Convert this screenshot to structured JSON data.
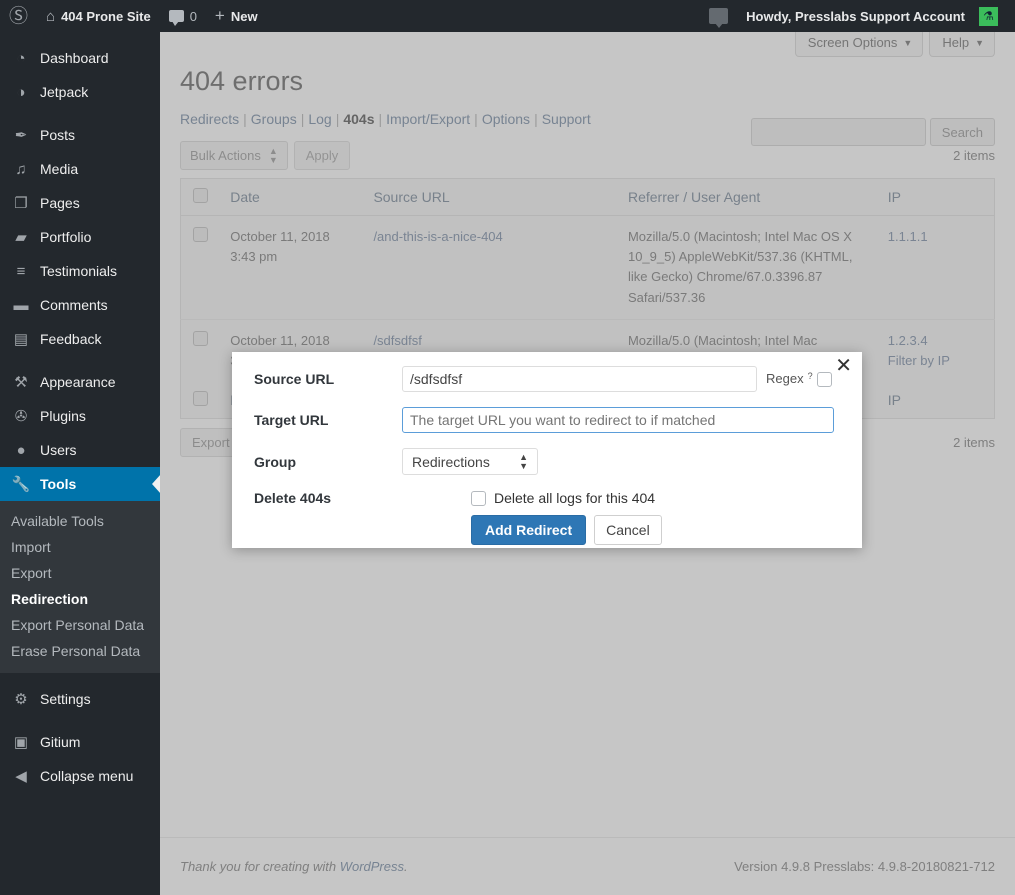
{
  "adminbar": {
    "logo_icon": "wordpress-logo-icon",
    "site_name": "404 Prone Site",
    "comments_count": "0",
    "new_label": "New",
    "greeting": "Howdy, Presslabs Support Account",
    "avatar_glyph": "⚗"
  },
  "sidebar": {
    "items": [
      {
        "label": "Dashboard",
        "icon": "dashboard-icon",
        "glyph": "◔"
      },
      {
        "label": "Jetpack",
        "icon": "jetpack-icon",
        "glyph": "◑"
      },
      {
        "label": "Posts",
        "icon": "pin-icon",
        "glyph": "✒"
      },
      {
        "label": "Media",
        "icon": "media-icon",
        "glyph": "♫"
      },
      {
        "label": "Pages",
        "icon": "pages-icon",
        "glyph": "❐"
      },
      {
        "label": "Portfolio",
        "icon": "portfolio-icon",
        "glyph": "▰"
      },
      {
        "label": "Testimonials",
        "icon": "testimonials-icon",
        "glyph": "≡"
      },
      {
        "label": "Comments",
        "icon": "comments-icon",
        "glyph": "▬"
      },
      {
        "label": "Feedback",
        "icon": "feedback-icon",
        "glyph": "▤"
      },
      {
        "label": "Appearance",
        "icon": "appearance-icon",
        "glyph": "⚒"
      },
      {
        "label": "Plugins",
        "icon": "plugins-icon",
        "glyph": "✇"
      },
      {
        "label": "Users",
        "icon": "users-icon",
        "glyph": "●"
      },
      {
        "label": "Tools",
        "icon": "tools-icon",
        "glyph": "⚙"
      },
      {
        "label": "Settings",
        "icon": "settings-icon",
        "glyph": "⚙"
      },
      {
        "label": "Gitium",
        "icon": "gitium-icon",
        "glyph": "▣"
      },
      {
        "label": "Collapse menu",
        "icon": "collapse-icon",
        "glyph": "◀"
      }
    ],
    "current_item": "Tools",
    "submenu": [
      {
        "label": "Available Tools",
        "active": false
      },
      {
        "label": "Import",
        "active": false
      },
      {
        "label": "Export",
        "active": false
      },
      {
        "label": "Redirection",
        "active": true
      },
      {
        "label": "Export Personal Data",
        "active": false
      },
      {
        "label": "Erase Personal Data",
        "active": false
      }
    ]
  },
  "screen_meta": {
    "screen_options": "Screen Options",
    "help": "Help",
    "caret": "▼"
  },
  "page": {
    "title": "404 errors",
    "subnav": [
      {
        "label": "Redirects",
        "current": false
      },
      {
        "label": "Groups",
        "current": false
      },
      {
        "label": "Log",
        "current": false
      },
      {
        "label": "404s",
        "current": true
      },
      {
        "label": "Import/Export",
        "current": false
      },
      {
        "label": "Options",
        "current": false
      },
      {
        "label": "Support",
        "current": false
      }
    ],
    "subnav_separator": "|"
  },
  "search": {
    "value": "",
    "placeholder": "",
    "button_label": "Search"
  },
  "tablenav": {
    "bulk_actions_label": "Bulk Actions",
    "apply_label": "Apply",
    "items_count": "2 items",
    "export_label": "Export",
    "items_count_bottom": "2 items"
  },
  "table": {
    "columns": [
      "Date",
      "Source URL",
      "Referrer / User Agent",
      "IP"
    ],
    "rows": [
      {
        "date": "October 11, 2018",
        "time": "3:43 pm",
        "source_url": "/and-this-is-a-nice-404",
        "user_agent": "Mozilla/5.0 (Macintosh; Intel Mac OS X 10_9_5) AppleWebKit/537.36 (KHTML, like Gecko) Chrome/67.0.3396.87 Safari/537.36",
        "ip": "1.1.1.1",
        "ip_action": ""
      },
      {
        "date": "October 11, 2018",
        "time": "3:",
        "source_url": "/sdfsdfsf",
        "user_agent": "Mozilla/5.0 (Macintosh; Intel Mac",
        "ip": "1.2.3.4",
        "ip_action": "Filter by IP"
      }
    ]
  },
  "modal": {
    "close_glyph": "✕",
    "source_url_label": "Source URL",
    "source_url_value": "/sdfsdfsf",
    "regex_label": "Regex",
    "regex_help": "?",
    "target_url_label": "Target URL",
    "target_url_value": "",
    "target_url_placeholder": "The target URL you want to redirect to if matched",
    "group_label": "Group",
    "group_value": "Redirections",
    "delete_404s_label": "Delete 404s",
    "delete_logs_label": "Delete all logs for this 404",
    "add_redirect_label": "Add Redirect",
    "cancel_label": "Cancel",
    "primary_color": "#2e77b5",
    "focus_border_color": "#5b9dd9"
  },
  "footer": {
    "thanks_prefix": "Thank you for creating with ",
    "wordpress_link": "WordPress",
    "thanks_suffix": ".",
    "version": "Version 4.9.8 Presslabs: 4.9.8-20180821-712"
  }
}
